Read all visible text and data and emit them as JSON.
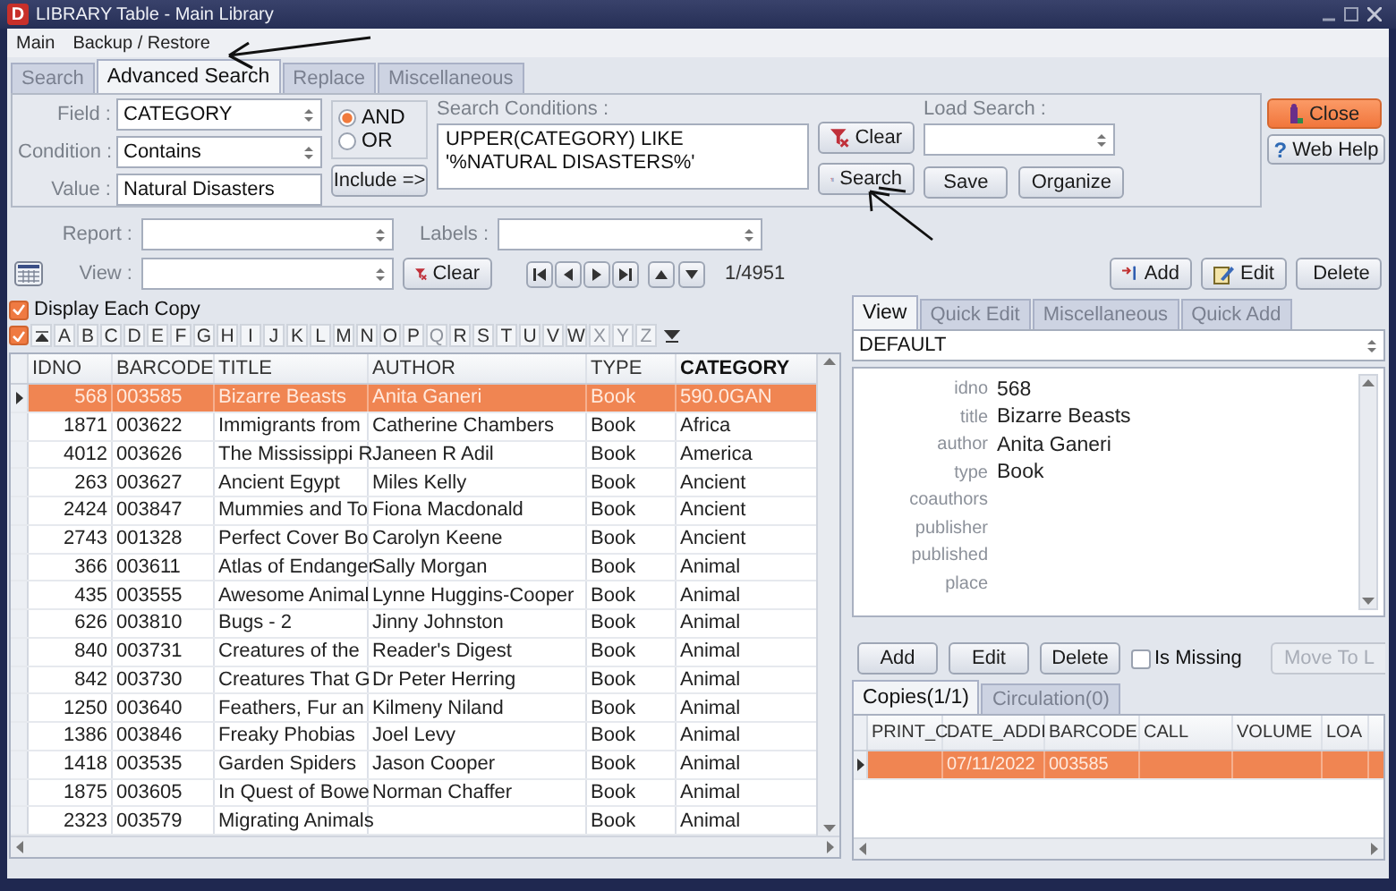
{
  "window": {
    "title": "LIBRARY Table - Main Library",
    "app_icon": "D"
  },
  "menu": [
    "Main",
    "Backup / Restore"
  ],
  "tabs": [
    {
      "label": "Search",
      "selected": false
    },
    {
      "label": "Advanced Search",
      "selected": true
    },
    {
      "label": "Replace",
      "selected": false
    },
    {
      "label": "Miscellaneous",
      "selected": false
    }
  ],
  "search": {
    "field_label": "Field :",
    "field": "CATEGORY",
    "condition_label": "Condition :",
    "condition": "Contains",
    "value_label": "Value :",
    "value": "Natural Disasters",
    "logic": [
      {
        "label": "AND",
        "selected": true
      },
      {
        "label": "OR",
        "selected": false
      }
    ],
    "include_button": "Include =>",
    "conditions_label": "Search Conditions :",
    "conditions": "UPPER(CATEGORY) LIKE '%NATURAL DISASTERS%'",
    "clear_button": "Clear",
    "search_button": "Search",
    "load_label": "Load Search :",
    "save_button": "Save",
    "organize_button": "Organize"
  },
  "side_buttons": {
    "close": "Close",
    "help_icon": "?",
    "help": "Web Help"
  },
  "report_label": "Report :",
  "labels_label": "Labels :",
  "view_label": "View :",
  "clear_button": "Clear",
  "record_counter": "1/4951",
  "record_buttons": [
    "Add",
    "Edit",
    "Delete"
  ],
  "display_each_copy": {
    "label": "Display Each Copy",
    "checked": true
  },
  "select_all": {
    "checked": true
  },
  "alphabet": [
    {
      "letter": "A",
      "disabled": false
    },
    {
      "letter": "B",
      "disabled": false
    },
    {
      "letter": "C",
      "disabled": false
    },
    {
      "letter": "D",
      "disabled": false
    },
    {
      "letter": "E",
      "disabled": false
    },
    {
      "letter": "F",
      "disabled": false
    },
    {
      "letter": "G",
      "disabled": false
    },
    {
      "letter": "H",
      "disabled": false
    },
    {
      "letter": "I",
      "disabled": false
    },
    {
      "letter": "J",
      "disabled": false
    },
    {
      "letter": "K",
      "disabled": false
    },
    {
      "letter": "L",
      "disabled": false
    },
    {
      "letter": "M",
      "disabled": false
    },
    {
      "letter": "N",
      "disabled": false
    },
    {
      "letter": "O",
      "disabled": false
    },
    {
      "letter": "P",
      "disabled": false
    },
    {
      "letter": "Q",
      "disabled": true
    },
    {
      "letter": "R",
      "disabled": false
    },
    {
      "letter": "S",
      "disabled": false
    },
    {
      "letter": "T",
      "disabled": false
    },
    {
      "letter": "U",
      "disabled": false
    },
    {
      "letter": "V",
      "disabled": false
    },
    {
      "letter": "W",
      "disabled": false
    },
    {
      "letter": "X",
      "disabled": true
    },
    {
      "letter": "Y",
      "disabled": true
    },
    {
      "letter": "Z",
      "disabled": true
    }
  ],
  "table": {
    "columns": [
      {
        "label": "IDNO",
        "sorted": false
      },
      {
        "label": "BARCODE",
        "sorted": false
      },
      {
        "label": "TITLE",
        "sorted": false
      },
      {
        "label": "AUTHOR",
        "sorted": false
      },
      {
        "label": "TYPE",
        "sorted": false
      },
      {
        "label": "CATEGORY",
        "sorted": true
      }
    ],
    "rows": [
      {
        "cells": [
          "568",
          "003585",
          "Bizarre Beasts",
          "Anita Ganeri",
          "Book",
          "590.0GAN"
        ],
        "selected": true
      },
      {
        "cells": [
          "1871",
          "003622",
          "Immigrants from",
          "Catherine Chambers",
          "Book",
          "Africa"
        ],
        "selected": false
      },
      {
        "cells": [
          "4012",
          "003626",
          "The Mississippi R",
          "Janeen R Adil",
          "Book",
          "America"
        ],
        "selected": false
      },
      {
        "cells": [
          "263",
          "003627",
          "Ancient Egypt",
          "Miles Kelly",
          "Book",
          "Ancient"
        ],
        "selected": false
      },
      {
        "cells": [
          "2424",
          "003847",
          "Mummies and To",
          "Fiona Macdonald",
          "Book",
          "Ancient"
        ],
        "selected": false
      },
      {
        "cells": [
          "2743",
          "001328",
          "Perfect Cover Bo",
          "Carolyn Keene",
          "Book",
          "Ancient"
        ],
        "selected": false
      },
      {
        "cells": [
          "366",
          "003611",
          "Atlas of Endanger",
          "Sally Morgan",
          "Book",
          "Animal"
        ],
        "selected": false
      },
      {
        "cells": [
          "435",
          "003555",
          "Awesome Animal",
          "Lynne Huggins-Cooper",
          "Book",
          "Animal"
        ],
        "selected": false
      },
      {
        "cells": [
          "626",
          "003810",
          "Bugs - 2",
          "Jinny Johnston",
          "Book",
          "Animal"
        ],
        "selected": false
      },
      {
        "cells": [
          "840",
          "003731",
          "Creatures of the",
          "Reader's Digest",
          "Book",
          "Animal"
        ],
        "selected": false
      },
      {
        "cells": [
          "842",
          "003730",
          "Creatures That G",
          "Dr Peter Herring",
          "Book",
          "Animal"
        ],
        "selected": false
      },
      {
        "cells": [
          "1250",
          "003640",
          "Feathers, Fur an",
          "Kilmeny Niland",
          "Book",
          "Animal"
        ],
        "selected": false
      },
      {
        "cells": [
          "1386",
          "003846",
          "Freaky Phobias",
          "Joel Levy",
          "Book",
          "Animal"
        ],
        "selected": false
      },
      {
        "cells": [
          "1418",
          "003535",
          "Garden Spiders",
          "Jason Cooper",
          "Book",
          "Animal"
        ],
        "selected": false
      },
      {
        "cells": [
          "1875",
          "003605",
          "In Quest of Bowe",
          "Norman Chaffer",
          "Book",
          "Animal"
        ],
        "selected": false
      },
      {
        "cells": [
          "2323",
          "003579",
          "Migrating Animals",
          null,
          "Book",
          "Animal"
        ],
        "selected": false
      }
    ]
  },
  "detail_tabs": [
    {
      "label": "View",
      "selected": true
    },
    {
      "label": "Quick Edit",
      "selected": false
    },
    {
      "label": "Miscellaneous",
      "selected": false
    },
    {
      "label": "Quick Add",
      "selected": false
    }
  ],
  "view_select": "DEFAULT",
  "fields": [
    {
      "label": "idno",
      "value": "568"
    },
    {
      "label": "title",
      "value": "Bizarre Beasts"
    },
    {
      "label": "author",
      "value": "Anita Ganeri"
    },
    {
      "label": "type",
      "value": "Book"
    },
    {
      "label": "coauthors"
    },
    {
      "label": "publisher"
    },
    {
      "label": "published"
    },
    {
      "label": "place"
    }
  ],
  "copy_buttons": [
    "Add",
    "Edit",
    "Delete"
  ],
  "is_missing": {
    "label": "Is Missing",
    "checked": false
  },
  "move_button": {
    "label": "Move To L",
    "disabled": true
  },
  "copy_tabs": [
    {
      "label": "Copies(1/1)",
      "selected": true
    },
    {
      "label": "Circulation(0)",
      "selected": false
    }
  ],
  "copies": {
    "columns": [
      {
        "label": "PRINT_C",
        "sorted": false
      },
      {
        "label": "DATE_ADDI",
        "sorted": false
      },
      {
        "label": "BARCODE",
        "sorted": false
      },
      {
        "label": "CALL",
        "sorted": false
      },
      {
        "label": "VOLUME",
        "sorted": false
      },
      {
        "label": "LOA",
        "sorted": false
      }
    ],
    "rows": [
      {
        "cells": [
          null,
          "07/11/2022",
          "003585",
          null,
          null,
          null
        ],
        "selected": true
      }
    ]
  }
}
